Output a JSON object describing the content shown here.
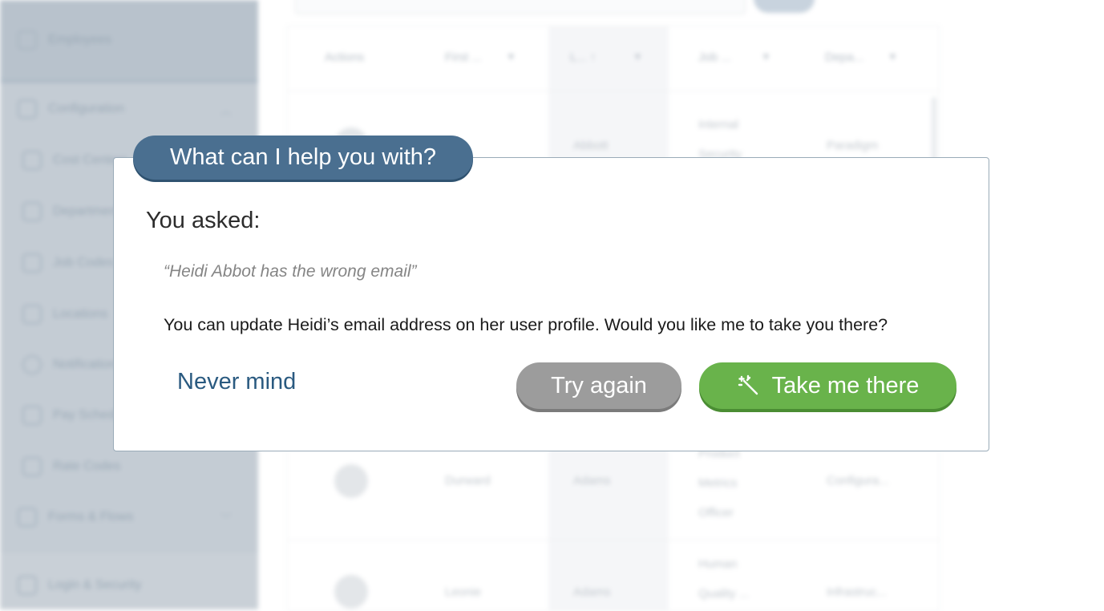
{
  "background": {
    "sidebar": {
      "items": [
        {
          "label": "Employees",
          "icon": "people-icon"
        },
        {
          "label": "Configuration",
          "icon": "gear-icon"
        },
        {
          "label": "Cost Centers",
          "icon": "cost-icon"
        },
        {
          "label": "Departments",
          "icon": "building-icon"
        },
        {
          "label": "Job Codes",
          "icon": "briefcase-icon"
        },
        {
          "label": "Locations",
          "icon": "location-icon"
        },
        {
          "label": "Notifications",
          "icon": "bell-icon"
        },
        {
          "label": "Pay Schedules",
          "icon": "calendar-icon"
        },
        {
          "label": "Rate Codes",
          "icon": "phone-icon"
        },
        {
          "label": "Forms & Flows",
          "icon": "forms-icon"
        },
        {
          "label": "Login & Security",
          "icon": "lock-icon"
        }
      ]
    },
    "table": {
      "columns": [
        "Actions",
        "First ...",
        "L... ↑",
        "Job ...",
        "Depa..."
      ],
      "rows": [
        {
          "first": "",
          "last": "Abbott",
          "job": "Internal Security ...",
          "dept": "Paradigm"
        },
        {
          "first": "Durward",
          "last": "Adams",
          "job": "Product Metrics Officer",
          "dept": "Configura..."
        },
        {
          "first": "Leonie",
          "last": "Adams",
          "job": "Human Quality ...",
          "dept": "Infrastruc..."
        }
      ]
    }
  },
  "dialog": {
    "tab_title": "What can I help you with?",
    "asked_heading": "You asked:",
    "query": "“Heidi Abbot has the wrong email”",
    "answer": "You can update Heidi’s email address on her user profile. Would you like me to take you there?",
    "never_mind_label": "Never mind",
    "try_again_label": "Try again",
    "take_me_there_label": "Take me there",
    "take_me_there_icon": "magic-wand-icon",
    "colors": {
      "tab": "#4a6f90",
      "link": "#2a5a80",
      "try_again": "#9c9c9c",
      "take_me_there": "#69b34b"
    }
  }
}
